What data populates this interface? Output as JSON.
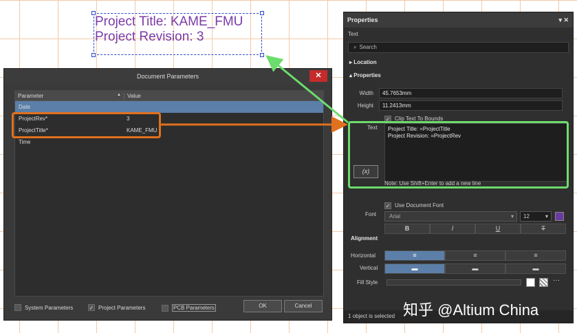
{
  "canvas": {
    "line1": "Project Title: KAME_FMU",
    "line2": "Project Revision: 3",
    "text_color": "#7a3aa8"
  },
  "document_parameters": {
    "title": "Document Parameters",
    "close_label": "✕",
    "columns": [
      "Parameter",
      "Value"
    ],
    "rows": [
      {
        "param": "Date",
        "value": "",
        "selected": true
      },
      {
        "param": "ProjectRev*",
        "value": "3"
      },
      {
        "param": "ProjectTitle*",
        "value": "KAME_FMU"
      },
      {
        "param": "Time",
        "value": ""
      }
    ],
    "checkboxes": [
      {
        "label": "System Parameters",
        "checked": false
      },
      {
        "label": "Project Parameters",
        "checked": true
      },
      {
        "label": "PCB Parameters",
        "checked": false
      }
    ],
    "ok_label": "OK",
    "cancel_label": "Cancel"
  },
  "properties": {
    "title": "Properties",
    "window_controls": "▾ ✕",
    "object_type": "Text",
    "search_placeholder": "Search",
    "location_section": "Location",
    "properties_section": "Properties",
    "width_label": "Width",
    "width_value": "45.7653mm",
    "height_label": "Height",
    "height_value": "11.2413mm",
    "clip_label": "Clip Text To Bounds",
    "clip_checked": true,
    "text_label": "Text",
    "text_line1": "Project Title: =ProjectTitle",
    "text_line2": "Project Revision: =ProjectRev",
    "fx_label": "(x)",
    "note": "Note: Use Shift+Enter to add a new line",
    "use_doc_font_label": "Use Document Font",
    "use_doc_font_checked": true,
    "font_label": "Font",
    "font_name": "Arial",
    "font_size": "12",
    "font_color": "#6a3aa0",
    "style_buttons": [
      "B",
      "I",
      "U",
      "T"
    ],
    "alignment_label": "Alignment",
    "horizontal_label": "Horizontal",
    "vertical_label": "Vertical",
    "fill_style_label": "Fill Style",
    "footer": "1 object is selected"
  },
  "watermark": "知乎 @Altium China",
  "colors": {
    "orange_callout": "#e0711e",
    "green_callout": "#6cdc6c",
    "selection": "#5b7fa8"
  }
}
